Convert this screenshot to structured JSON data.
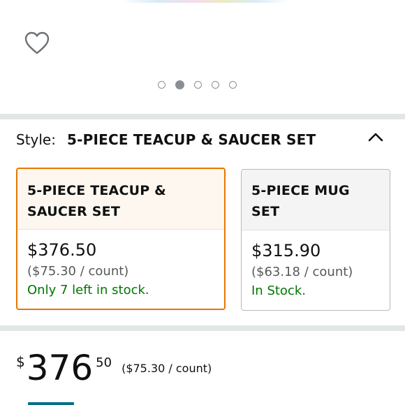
{
  "gallery": {
    "favorite_icon": "heart-outline-icon",
    "dots": [
      {
        "active": false
      },
      {
        "active": true
      },
      {
        "active": false
      },
      {
        "active": false
      },
      {
        "active": false
      }
    ]
  },
  "style_selector": {
    "label": "Style:",
    "selected_value": "5-PIECE TEACUP & SAUCER SET",
    "toggle_icon": "chevron-up-icon",
    "options": [
      {
        "name_line1": "5-PIECE TEACUP &",
        "name_line2": "SAUCER SET",
        "price": "$376.50",
        "unit_price": "($75.30 / count)",
        "stock": "Only 7 left in stock.",
        "selected": true
      },
      {
        "name_line1": "5-PIECE MUG SET",
        "name_line2": "",
        "price": "$315.90",
        "unit_price": "($63.18 / count)",
        "stock": "In Stock.",
        "selected": false
      }
    ]
  },
  "price_block": {
    "currency": "$",
    "whole": "376",
    "fraction": "50",
    "unit_price": "($75.30 / count)"
  },
  "colors": {
    "selected_border": "#e77600",
    "in_stock": "#007600",
    "divider": "#e3e6e6",
    "accent": "#007185"
  }
}
